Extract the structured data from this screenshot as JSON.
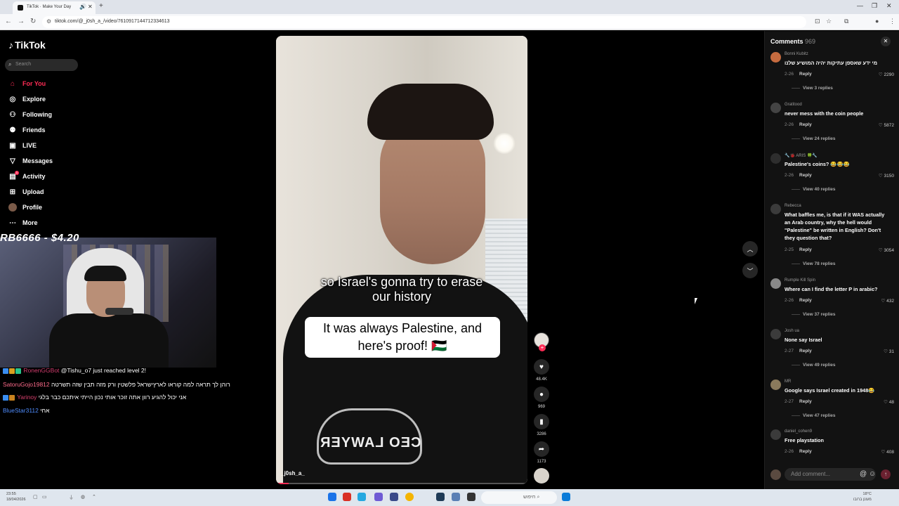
{
  "browser": {
    "tab_title": "TikTok · Make Your Day",
    "url": "tiktok.com/@_j0sh_a_/video/7610917144712334613"
  },
  "sidebar": {
    "logo": "TikTok",
    "search_placeholder": "Search",
    "items": [
      {
        "label": "For You",
        "icon": "home-icon",
        "active": true
      },
      {
        "label": "Explore",
        "icon": "compass-icon"
      },
      {
        "label": "Following",
        "icon": "following-icon"
      },
      {
        "label": "Friends",
        "icon": "friends-icon"
      },
      {
        "label": "LIVE",
        "icon": "live-icon"
      },
      {
        "label": "Messages",
        "icon": "messages-icon"
      },
      {
        "label": "Activity",
        "icon": "activity-icon",
        "badge": "1"
      },
      {
        "label": "Upload",
        "icon": "upload-icon"
      },
      {
        "label": "Profile",
        "icon": "profile-avatar"
      },
      {
        "label": "More",
        "icon": "more-icon"
      }
    ]
  },
  "stream": {
    "donation": "RB6666 - $4.20",
    "chat": [
      {
        "user": "RonenGGBot",
        "text": " @Tishu_o7 just reached level 2!"
      },
      {
        "user": "SatoruGojo19812",
        "text": " רוהן לך תראה למה קוראו לארץישראל פלשטין ורק מזה תבין שזה תשרטה"
      },
      {
        "user": "Yarinoy",
        "text": " אני יכול להגיע רוון אתה זוכר אותי נכון הייתי איתכם כבר בלגי"
      },
      {
        "user": "BlueStar3112",
        "text": " אחי"
      }
    ]
  },
  "video": {
    "caption_line1": "so Israel's gonna try to erase",
    "caption_line2": "our history",
    "overlay_line1": "It was always Palestine, and",
    "overlay_line2": "here's proof! 🇵🇸",
    "shirt_logo": "CEO LAWYER",
    "username": "_j0sh_a_",
    "progress": 0.05,
    "likes": "48.4K",
    "comments": "969",
    "bookmarks": "3286",
    "shares": "1173"
  },
  "comments_panel": {
    "title": "Comments",
    "count": "969",
    "reply_label": "Reply",
    "add_placeholder": "Add comment...",
    "items": [
      {
        "user": "Bonni Kubitz",
        "text": "מי ידע שאספן עתיקות יהיה המושיע שלנו",
        "date": "2-26",
        "likes": "2290",
        "replies": "View 3 replies"
      },
      {
        "user": "Gratitood",
        "text": "never mess with the coin people",
        "date": "2-26",
        "likes": "5872",
        "replies": "View 24 replies"
      },
      {
        "user": "🔧🐞 ARIS 🍀🔧",
        "text": "Palestine's coins? 😂😂😂",
        "date": "2-26",
        "likes": "3150",
        "replies": "View 40 replies"
      },
      {
        "user": "Rebecca",
        "text": "What baffles me, is that if it WAS actually an Arab country, why the hell would \"Palestine\" be written in English? Don't they question that?",
        "date": "2-25",
        "likes": "3054",
        "replies": "View 78 replies"
      },
      {
        "user": "Rumple Kill Spin",
        "text": "Where can I find the letter P in arabic?",
        "date": "2-26",
        "likes": "432",
        "replies": "View 37 replies"
      },
      {
        "user": "Josh ua",
        "text": "None say Israel",
        "date": "2-27",
        "likes": "31",
        "replies": "View 49 replies"
      },
      {
        "user": "MR",
        "text": "Google says Israel created in 1948😂",
        "date": "2-27",
        "likes": "48",
        "replies": "View 47 replies"
      },
      {
        "user": "daniel_cohen9",
        "text": "Free playstation",
        "date": "2-26",
        "likes": "408",
        "replies": ""
      }
    ]
  },
  "taskbar": {
    "time": "23:55",
    "date": "18/04/2026",
    "search": "חיפוש",
    "temp": "18°C",
    "weather": "מעונן ברובו"
  }
}
